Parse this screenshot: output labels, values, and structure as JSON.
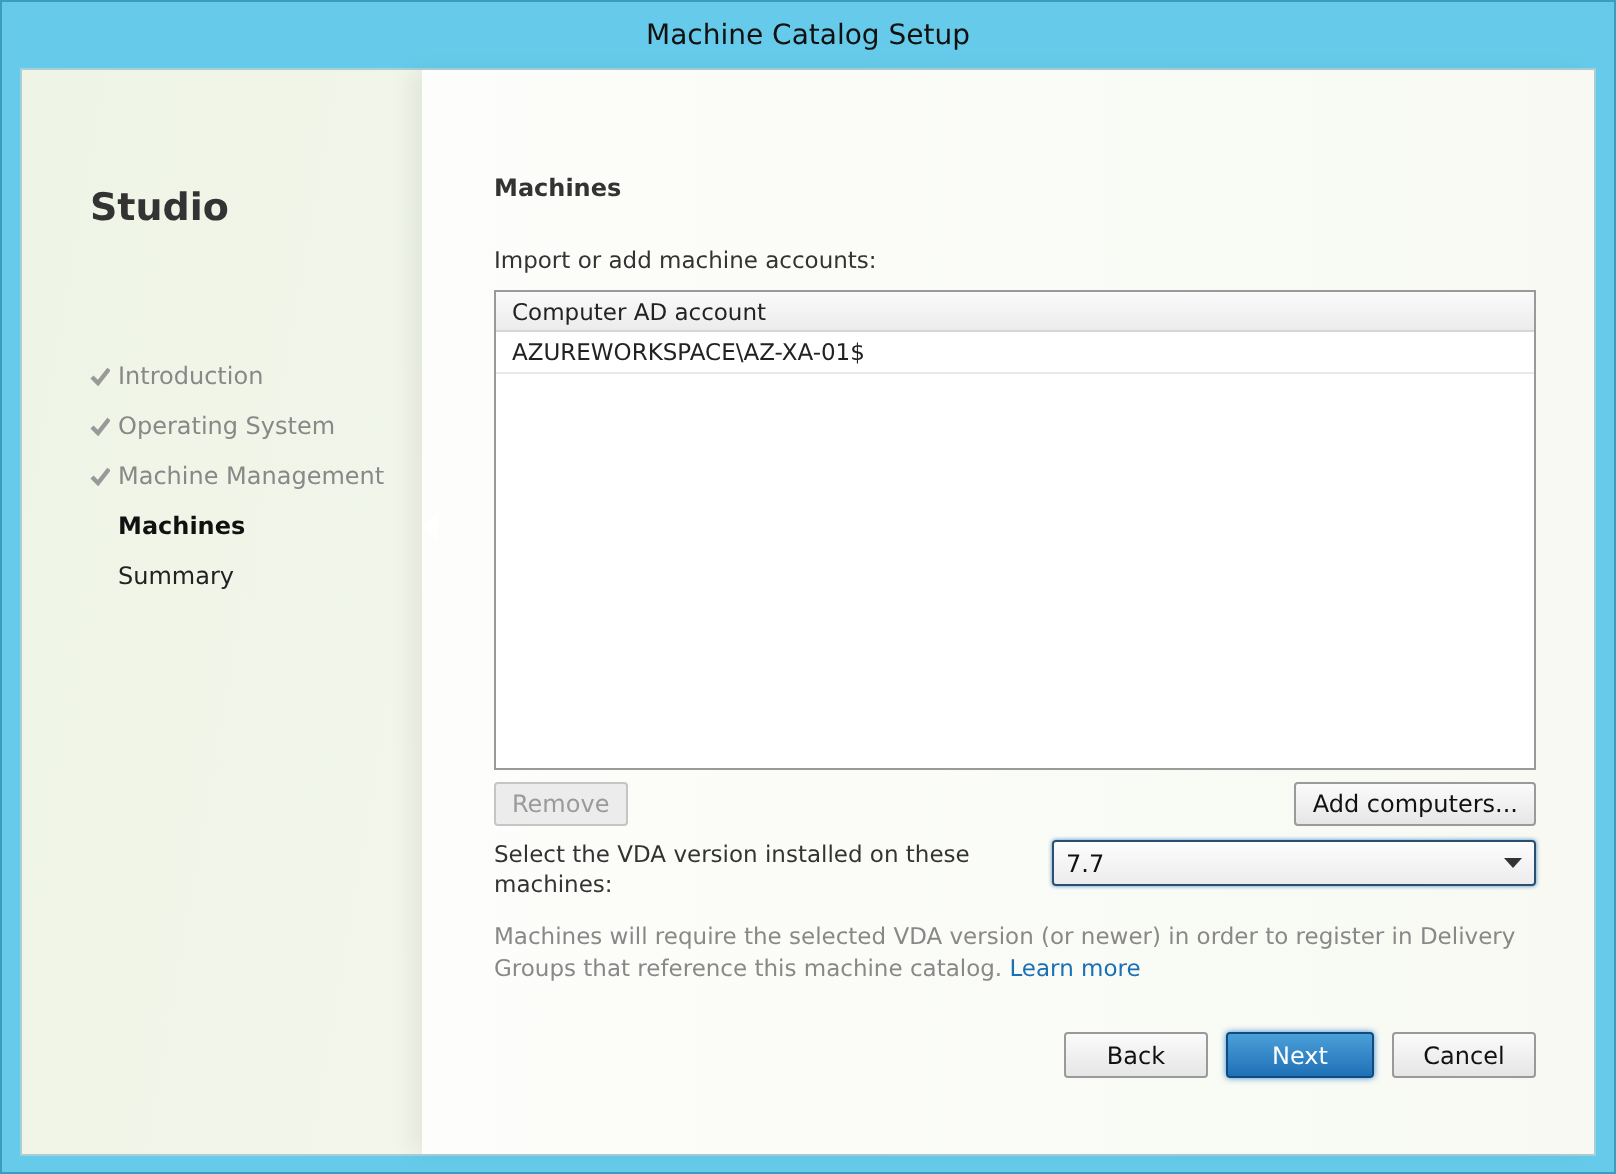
{
  "window": {
    "title": "Machine Catalog Setup"
  },
  "sidebar": {
    "brand": "Studio",
    "steps": [
      {
        "label": "Introduction",
        "done": true,
        "selected": false
      },
      {
        "label": "Operating System",
        "done": true,
        "selected": false
      },
      {
        "label": "Machine Management",
        "done": true,
        "selected": false
      },
      {
        "label": "Machines",
        "done": false,
        "selected": true
      },
      {
        "label": "Summary",
        "done": false,
        "selected": false
      }
    ]
  },
  "page": {
    "heading": "Machines",
    "table_label": "Import or add machine accounts:",
    "table": {
      "columns": [
        "Computer AD account"
      ],
      "rows": [
        [
          "AZUREWORKSPACE\\AZ-XA-01$"
        ]
      ]
    },
    "remove_button": {
      "label": "Remove",
      "disabled": true
    },
    "add_button": {
      "label": "Add computers...",
      "disabled": false
    },
    "vda": {
      "label": "Select the VDA version installed on these machines:",
      "value": "7.7"
    },
    "note": "Machines will require the selected VDA version (or newer) in order to register in Delivery Groups that reference this machine catalog.",
    "note_link": "Learn more"
  },
  "buttons": [
    {
      "label": "Back",
      "kind": "normal"
    },
    {
      "label": "Next",
      "kind": "default"
    },
    {
      "label": "Cancel",
      "kind": "normal"
    }
  ]
}
